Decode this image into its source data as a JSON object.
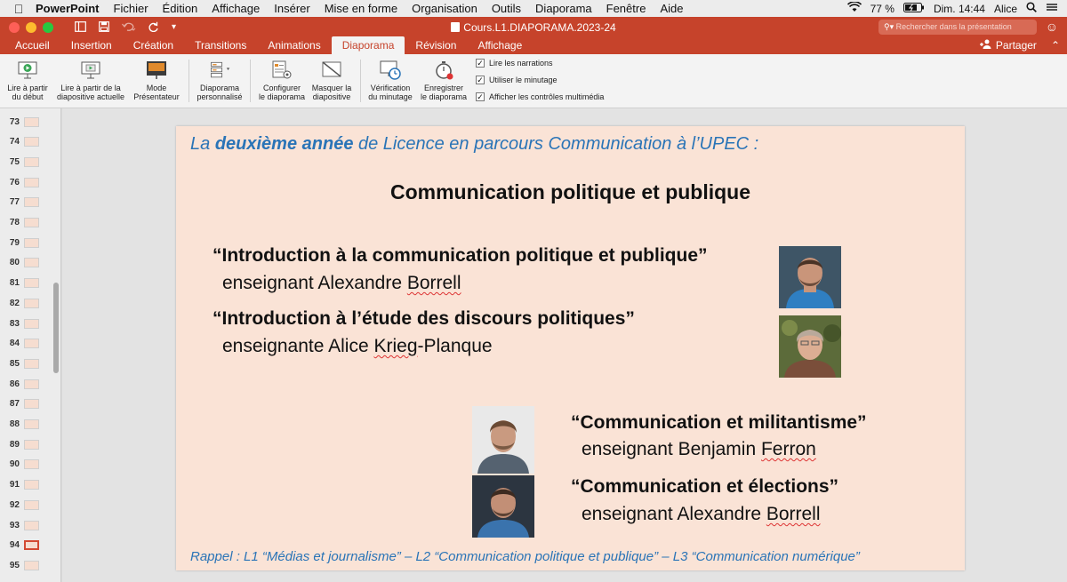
{
  "menubar": {
    "app": "PowerPoint",
    "items": [
      "Fichier",
      "Édition",
      "Affichage",
      "Insérer",
      "Mise en forme",
      "Organisation",
      "Outils",
      "Diaporama",
      "Fenêtre",
      "Aide"
    ],
    "battery": "77 %",
    "clock": "Dim. 14:44",
    "user": "Alice"
  },
  "window": {
    "title": "Cours.L1.DIAPORAMA.2023-24",
    "search_placeholder": "Rechercher dans la présentation",
    "share": "Partager"
  },
  "tabs": [
    "Accueil",
    "Insertion",
    "Création",
    "Transitions",
    "Animations",
    "Diaporama",
    "Révision",
    "Affichage"
  ],
  "active_tab": "Diaporama",
  "ribbon": {
    "play_start": [
      "Lire à partir",
      "du début"
    ],
    "play_current": [
      "Lire à partir de la",
      "diapositive actuelle"
    ],
    "presenter": [
      "Mode",
      "Présentateur"
    ],
    "custom": [
      "Diaporama",
      "personnalisé"
    ],
    "setup": [
      "Configurer",
      "le diaporama"
    ],
    "hide": [
      "Masquer la",
      "diapositive"
    ],
    "rehearse": [
      "Vérification",
      "du minutage"
    ],
    "record": [
      "Enregistrer",
      "le diaporama"
    ],
    "checkboxes": [
      "Lire les narrations",
      "Utiliser le minutage",
      "Afficher les contrôles multimédia"
    ]
  },
  "thumbnails": {
    "numbers": [
      "73",
      "74",
      "75",
      "76",
      "77",
      "78",
      "79",
      "80",
      "81",
      "82",
      "83",
      "84",
      "85",
      "86",
      "87",
      "88",
      "89",
      "90",
      "91",
      "92",
      "93",
      "94",
      "95"
    ],
    "selected": "94"
  },
  "slide": {
    "head_a": "La ",
    "head_b": "deuxième année",
    "head_c": " de Licence en parcours Communication à l’UPEC :",
    "title": "Communication politique et publique",
    "course1": "“Introduction à la communication politique et publique”",
    "teacher1_a": "enseignant Alexandre ",
    "teacher1_b": "Borrell",
    "course2": "“Introduction à l’étude des discours politiques”",
    "teacher2_a": "enseignante Alice ",
    "teacher2_b": "Krieg",
    "teacher2_c": "-Planque",
    "course3": "“Communication et militantisme”",
    "teacher3_a": "enseignant Benjamin ",
    "teacher3_b": "Ferron",
    "course4": "“Communication et élections”",
    "teacher4_a": "enseignant Alexandre ",
    "teacher4_b": "Borrell",
    "footer": "Rappel : L1 “Médias et journalisme” – L2 “Communication politique et publique” – L3 “Communication numérique”"
  },
  "colors": {
    "brand": "#c6432b",
    "slide_bg": "#fae3d6",
    "heading_blue": "#2a74b7"
  }
}
